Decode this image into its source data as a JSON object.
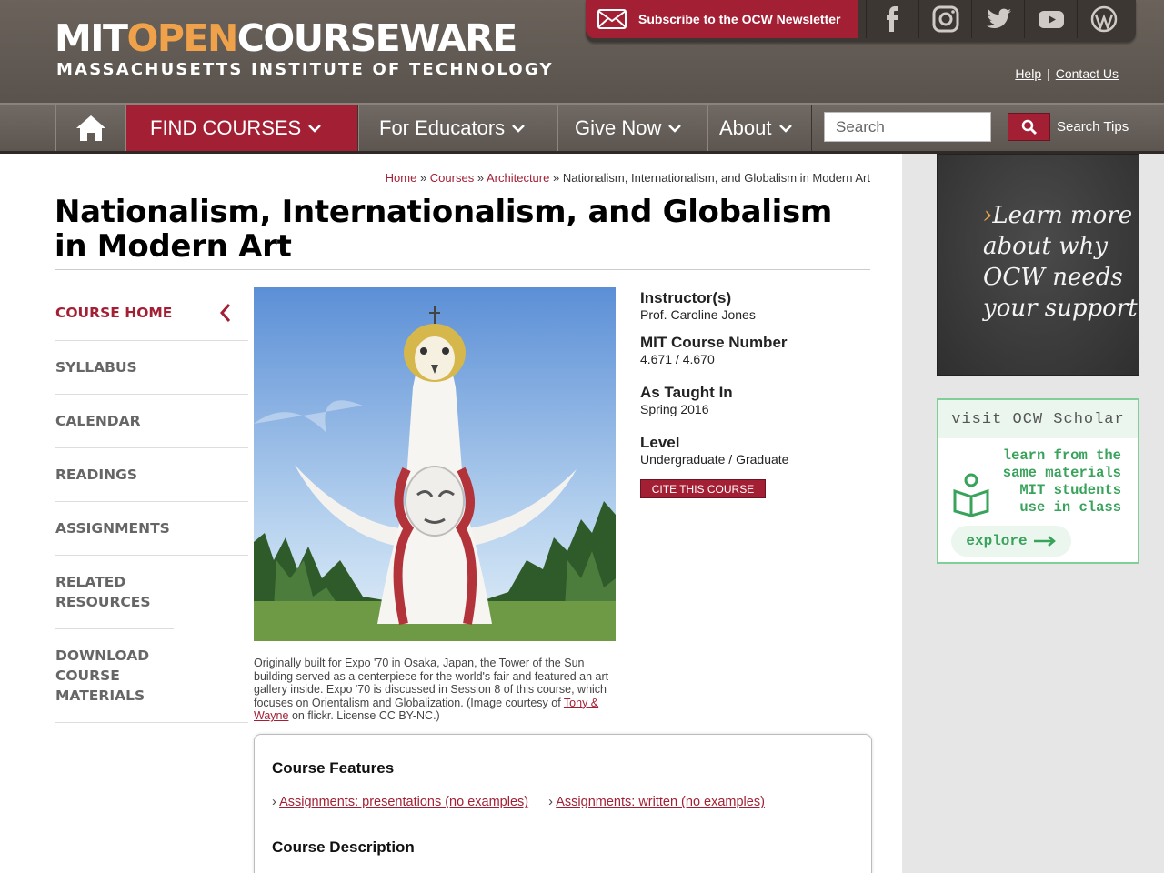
{
  "header": {
    "logo": {
      "part1": "MIT",
      "part2": "OPEN",
      "part3": "COURSEWARE",
      "subtitle": "MASSACHUSETTS INSTITUTE OF TECHNOLOGY"
    },
    "subscribe_label": "Subscribe to the OCW Newsletter",
    "social": [
      "facebook-icon",
      "instagram-icon",
      "twitter-icon",
      "youtube-icon",
      "wordpress-icon"
    ],
    "help": "Help",
    "contact": "Contact Us"
  },
  "nav": {
    "find_courses": "FIND COURSES",
    "for_educators": "For Educators",
    "give_now": "Give Now",
    "about": "About",
    "search_placeholder": "Search",
    "search_tips": "Search Tips"
  },
  "breadcrumb": {
    "home": "Home",
    "courses": "Courses",
    "architecture": "Architecture",
    "current": "Nationalism, Internationalism, and Globalism in Modern Art",
    "sep": "»"
  },
  "page": {
    "title": "Nationalism, Internationalism, and Globalism in Modern Art"
  },
  "sidebar": {
    "items": [
      {
        "label": "COURSE HOME"
      },
      {
        "label": "SYLLABUS"
      },
      {
        "label": "CALENDAR"
      },
      {
        "label": "READINGS"
      },
      {
        "label": "ASSIGNMENTS"
      },
      {
        "label": "RELATED RESOURCES"
      },
      {
        "label": "DOWNLOAD COURSE MATERIALS"
      }
    ]
  },
  "caption": {
    "text_before": "Originally built for Expo '70 in Osaka, Japan, the Tower of the Sun building served as a centerpiece for the world's fair and featured an art gallery inside. Expo '70 is discussed in Session 8 of this course, which focuses on Orientalism and Globalization. (Image courtesy of",
    "link": "Tony & Wayne",
    "text_after": "on flickr. License CC BY-NC.)"
  },
  "meta": {
    "instructor_h": "Instructor(s)",
    "instructor_v": "Prof. Caroline Jones",
    "number_h": "MIT Course Number",
    "number_v": "4.671 / 4.670",
    "taught_h": "As Taught In",
    "taught_v": "Spring 2016",
    "level_h": "Level",
    "level_v": "Undergraduate / Graduate",
    "cite": "CITE THIS COURSE"
  },
  "promo": {
    "chalk_line1": "Learn more",
    "chalk_line2": "about why",
    "chalk_line3": "OCW needs",
    "chalk_line4": "your support",
    "scholar_title": "visit OCW Scholar",
    "scholar_line1": "learn from the",
    "scholar_line2": "same materials",
    "scholar_line3": "MIT students",
    "scholar_line4": "use in class",
    "scholar_explore": "explore"
  },
  "features": {
    "heading": "Course Features",
    "link1": "Assignments: presentations (no examples)",
    "link2": "Assignments: written (no examples)",
    "description_heading": "Course Description"
  },
  "colors": {
    "brand_red": "#a31f34",
    "header_gray": "#5f5852",
    "accent_orange": "#f0a24a",
    "scholar_green": "#39a35c"
  }
}
